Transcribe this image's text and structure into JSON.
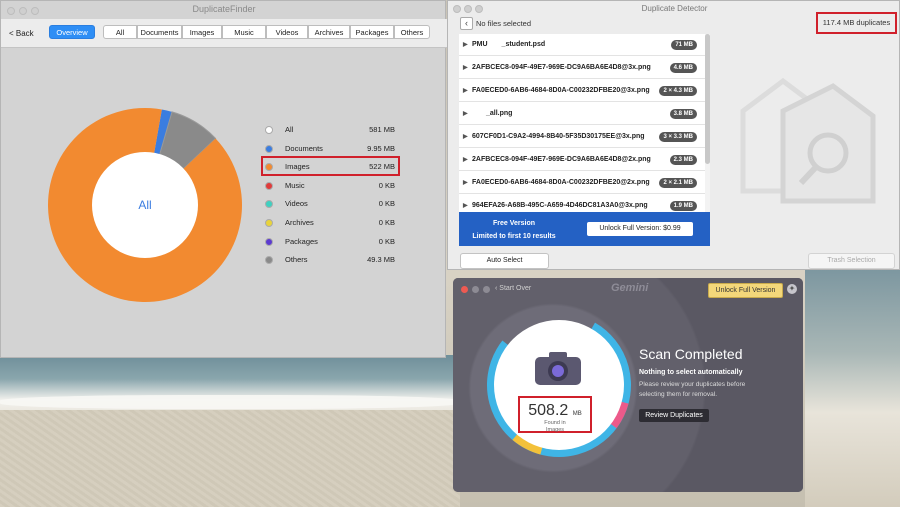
{
  "colors": {
    "accent": "#2e8ef5",
    "orange": "#f28a30",
    "gray": "#8a8a8a",
    "highlight": "#d0202b",
    "promo_blue": "#2461c4"
  },
  "duplicate_finder": {
    "title": "DuplicateFinder",
    "back_label": "< Back",
    "tabs": [
      "Overview",
      "All",
      "Documents",
      "Images",
      "Music",
      "Videos",
      "Archives",
      "Packages",
      "Others"
    ],
    "active_tab": "Overview",
    "center_label": "All",
    "chart_data": {
      "type": "pie",
      "categories": [
        "Documents",
        "Images",
        "Music",
        "Videos",
        "Archives",
        "Packages",
        "Others"
      ],
      "values": [
        9.95,
        522,
        0,
        0,
        0,
        0,
        49.3
      ],
      "unit": "MB"
    },
    "legend": [
      {
        "label": "All",
        "value": "581 MB",
        "color": "#ffffff"
      },
      {
        "label": "Documents",
        "value": "9.95 MB",
        "color": "#3b7de0"
      },
      {
        "label": "Images",
        "value": "522 MB",
        "color": "#f28a30"
      },
      {
        "label": "Music",
        "value": "0 KB",
        "color": "#e03b3b"
      },
      {
        "label": "Videos",
        "value": "0 KB",
        "color": "#3fd0c0"
      },
      {
        "label": "Archives",
        "value": "0 KB",
        "color": "#e8d33b"
      },
      {
        "label": "Packages",
        "value": "0 KB",
        "color": "#5c3bd0"
      },
      {
        "label": "Others",
        "value": "49.3 MB",
        "color": "#8a8a8a"
      }
    ]
  },
  "duplicate_detector": {
    "title": "Duplicate Detector",
    "selection_status": "No files selected",
    "duplicates_total": "117.4 MB duplicates",
    "files": [
      {
        "name": "PMU  _student.psd",
        "size": "71 MB"
      },
      {
        "name": "2AFBCEC8-094F-49E7-969E-DC9A6BA6E4D8@3x.png",
        "size": "4.6 MB"
      },
      {
        "name": "FA0ECED0-6AB6-4684-8D0A-C00232DFBE20@3x.png",
        "size": "2 × 4.3 MB"
      },
      {
        "name": "  _all.png",
        "size": "3.8 MB"
      },
      {
        "name": "607CF0D1-C9A2-4994-8B40-5F35D30175EE@3x.png",
        "size": "3 × 3.3 MB"
      },
      {
        "name": "2AFBCEC8-094F-49E7-969E-DC9A6BA6E4D8@2x.png",
        "size": "2.3 MB"
      },
      {
        "name": "FA0ECED0-6AB6-4684-8D0A-C00232DFBE20@2x.png",
        "size": "2 × 2.1 MB"
      },
      {
        "name": "964EFA26-A68B-495C-A659-4D46DC81A3A0@3x.png",
        "size": "1.9 MB"
      }
    ],
    "promo_title": "Free Version",
    "promo_subtitle": "Limited to first 10 results",
    "unlock_label": "Unlock Full Version: $0.99",
    "auto_select_label": "Auto Select",
    "trash_label": "Trash Selection"
  },
  "gemini": {
    "start_over": "Start Over",
    "logo": "Gemini",
    "unlock_label": "Unlock Full Version",
    "found_size": "508.2",
    "found_unit": "MB",
    "found_line1": "Found in",
    "found_line2": "Images",
    "scan_title": "Scan Completed",
    "nothing_text": "Nothing to select automatically",
    "review_text": "Please review your duplicates before selecting them for removal.",
    "review_button": "Review Duplicates"
  }
}
